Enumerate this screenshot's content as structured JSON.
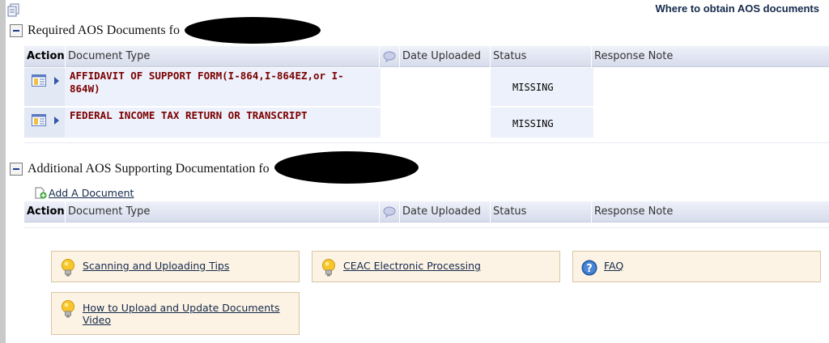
{
  "page": {
    "top_link": "Where to obtain AOS documents"
  },
  "required_section": {
    "title": "Required AOS Documents fo",
    "columns": {
      "action": "Action",
      "document_type": "Document Type",
      "date_uploaded": "Date Uploaded",
      "status": "Status",
      "response_note": "Response Note"
    },
    "rows": [
      {
        "document_type": "AFFIDAVIT OF SUPPORT FORM(I-864,I-864EZ,or I-864W)",
        "date_uploaded": "",
        "status": "MISSING",
        "response_note": ""
      },
      {
        "document_type": "FEDERAL INCOME TAX RETURN OR TRANSCRIPT",
        "date_uploaded": "",
        "status": "MISSING",
        "response_note": ""
      }
    ]
  },
  "additional_section": {
    "title": "Additional AOS Supporting Documentation fo",
    "add_document_label": "Add A Document",
    "columns": {
      "action": "Action",
      "document_type": "Document Type",
      "date_uploaded": "Date Uploaded",
      "status": "Status",
      "response_note": "Response Note"
    }
  },
  "help_links": [
    {
      "label": "Scanning and Uploading Tips",
      "icon": "lightbulb-icon"
    },
    {
      "label": "CEAC Electronic Processing",
      "icon": "lightbulb-icon"
    },
    {
      "label": "FAQ",
      "icon": "question-icon"
    },
    {
      "label": "How to Upload and Update Documents Video",
      "icon": "lightbulb-icon"
    }
  ],
  "colors": {
    "doc_type_text": "#7a0000",
    "link_text": "#13294b",
    "header_band": "#d7dcec",
    "tip_background": "#fdf3e4"
  }
}
